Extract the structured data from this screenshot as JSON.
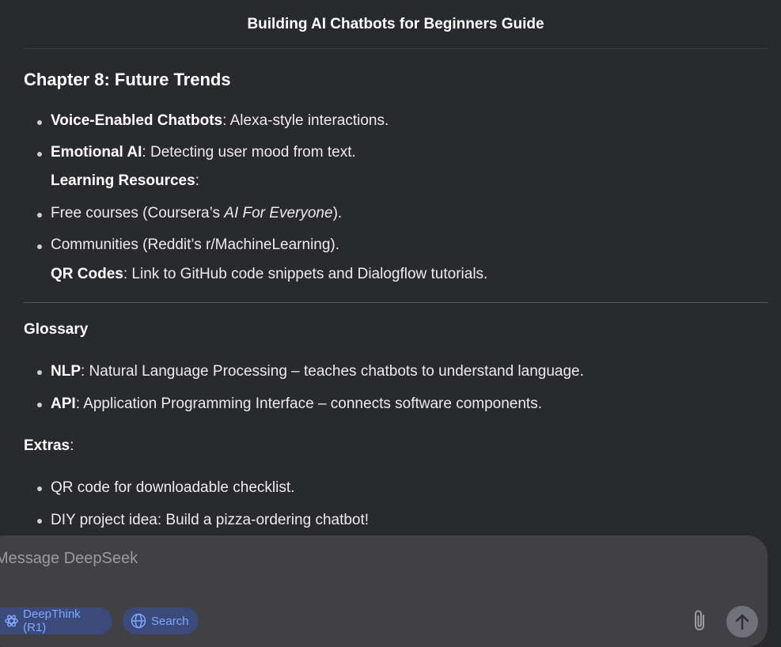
{
  "header": {
    "title": "Building AI Chatbots for Beginners Guide"
  },
  "chapter8": {
    "heading": "Chapter 8: Future Trends",
    "items": [
      {
        "bold": "Voice-Enabled Chatbots",
        "text": ": Alexa-style interactions."
      },
      {
        "bold": "Emotional AI",
        "text": ": Detecting user mood from text."
      }
    ],
    "resources_label": {
      "bold": "Learning Resources",
      "text": ":"
    },
    "resources": [
      {
        "pre": "Free courses (Coursera’s ",
        "italic": "AI For Everyone",
        "post": ")."
      },
      {
        "text": "Communities (Reddit’s r/MachineLearning)."
      }
    ],
    "qr": {
      "bold": "QR Codes",
      "text": ": Link to GitHub code snippets and Dialogflow tutorials."
    }
  },
  "glossary": {
    "heading": "Glossary",
    "items": [
      {
        "bold": "NLP",
        "text": ": Natural Language Processing – teaches chatbots to understand language."
      },
      {
        "bold": "API",
        "text": ": Application Programming Interface – connects software components."
      }
    ]
  },
  "extras": {
    "label": {
      "bold": "Extras",
      "text": ":"
    },
    "items": [
      "QR code for downloadable checklist.",
      "DIY project idea: Build a pizza-ordering chatbot!"
    ]
  },
  "composer": {
    "placeholder": "Message DeepSeek",
    "deepthink_label": "DeepThink (R1)",
    "search_label": "Search"
  },
  "colors": {
    "accent": "#7fa8ff",
    "pill_bg": "#3b4a7a",
    "background": "#292a2d",
    "composer_bg": "#404045"
  }
}
